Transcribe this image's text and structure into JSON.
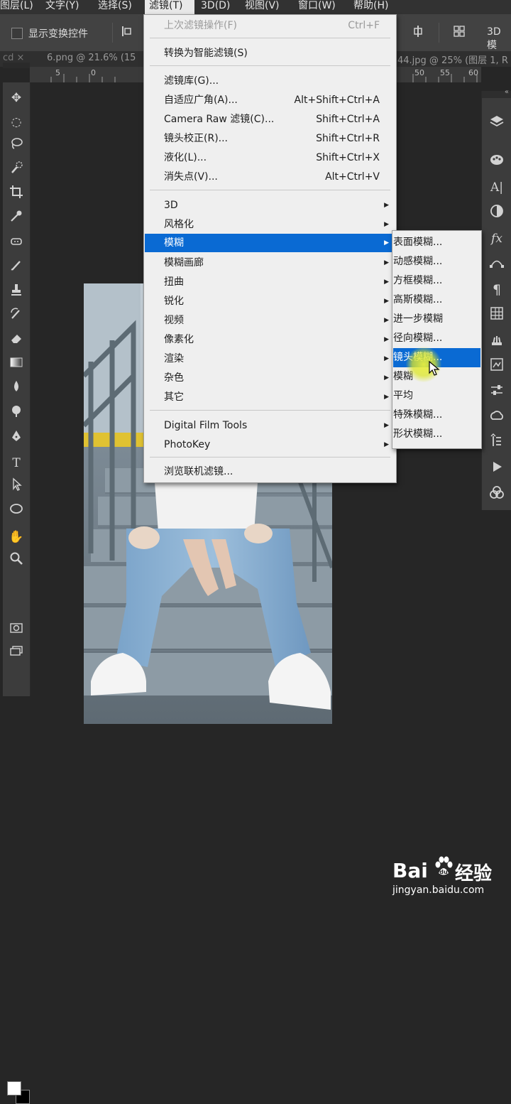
{
  "menubar": {
    "items": [
      {
        "label": "图层(L)"
      },
      {
        "label": "文字(Y)"
      },
      {
        "label": "选择(S)"
      },
      {
        "label": "滤镜(T)"
      },
      {
        "label": "3D(D)"
      },
      {
        "label": "视图(V)"
      },
      {
        "label": "窗口(W)"
      },
      {
        "label": "帮助(H)"
      }
    ]
  },
  "options": {
    "show_transform_controls": "显示变换控件",
    "label_3d": "3D 模"
  },
  "tabs": {
    "tab1": "6.png @ 21.6% (15",
    "tab2": "44.jpg @ 25% (图层 1, R"
  },
  "ruler": {
    "ticks": [
      "5",
      "0",
      "50",
      "55",
      "60"
    ]
  },
  "filter_menu": {
    "last_filter": {
      "label": "上次滤镜操作(F)",
      "shortcut": "Ctrl+F"
    },
    "smart_filter": {
      "label": "转换为智能滤镜(S)"
    },
    "gallery": {
      "label": "滤镜库(G)..."
    },
    "adaptive_wide": {
      "label": "自适应广角(A)...",
      "shortcut": "Alt+Shift+Ctrl+A"
    },
    "camera_raw": {
      "label": "Camera Raw 滤镜(C)...",
      "shortcut": "Shift+Ctrl+A"
    },
    "lens_correction": {
      "label": "镜头校正(R)...",
      "shortcut": "Shift+Ctrl+R"
    },
    "liquify": {
      "label": "液化(L)...",
      "shortcut": "Shift+Ctrl+X"
    },
    "vanishing_point": {
      "label": "消失点(V)...",
      "shortcut": "Alt+Ctrl+V"
    },
    "groups": [
      {
        "label": "3D"
      },
      {
        "label": "风格化"
      },
      {
        "label": "模糊"
      },
      {
        "label": "模糊画廊"
      },
      {
        "label": "扭曲"
      },
      {
        "label": "锐化"
      },
      {
        "label": "视频"
      },
      {
        "label": "像素化"
      },
      {
        "label": "渲染"
      },
      {
        "label": "杂色"
      },
      {
        "label": "其它"
      }
    ],
    "plugins": [
      {
        "label": "Digital Film Tools"
      },
      {
        "label": "PhotoKey"
      }
    ],
    "browse_online": {
      "label": "浏览联机滤镜..."
    }
  },
  "blur_submenu": {
    "items": [
      {
        "label": "表面模糊..."
      },
      {
        "label": "动感模糊..."
      },
      {
        "label": "方框模糊..."
      },
      {
        "label": "高斯模糊..."
      },
      {
        "label": "进一步模糊"
      },
      {
        "label": "径向模糊..."
      },
      {
        "label": "镜头模糊..."
      },
      {
        "label": "模糊"
      },
      {
        "label": "平均"
      },
      {
        "label": "特殊模糊..."
      },
      {
        "label": "形状模糊..."
      }
    ]
  },
  "watermark": {
    "brand_en": "Bai",
    "brand_cn": "经验",
    "url": "jingyan.baidu.com"
  },
  "colors": {
    "highlight": "#0a6ad3",
    "menu_bg": "#efefef",
    "app_bg": "#262626"
  },
  "icons": {
    "left_toolbar": [
      "move-icon",
      "elliptical-marquee-icon",
      "lasso-icon",
      "quick-selection-icon",
      "crop-icon",
      "eyedropper-icon",
      "healing-brush-icon",
      "brush-icon",
      "clone-stamp-icon",
      "history-brush-icon",
      "eraser-icon",
      "gradient-icon",
      "blur-tool-icon",
      "dodge-icon",
      "pen-icon",
      "type-icon",
      "path-selection-icon",
      "ellipse-shape-icon",
      "hand-icon",
      "zoom-icon"
    ],
    "right_panel": [
      "layers-icon",
      "color-icon",
      "character-icon",
      "adjustments-icon",
      "fx-icon",
      "paths-icon",
      "paragraph-icon",
      "swatches-icon",
      "brushes-icon",
      "properties-icon",
      "levels-icon",
      "cc-libraries-icon",
      "history-icon",
      "actions-icon",
      "3d-icon"
    ]
  }
}
